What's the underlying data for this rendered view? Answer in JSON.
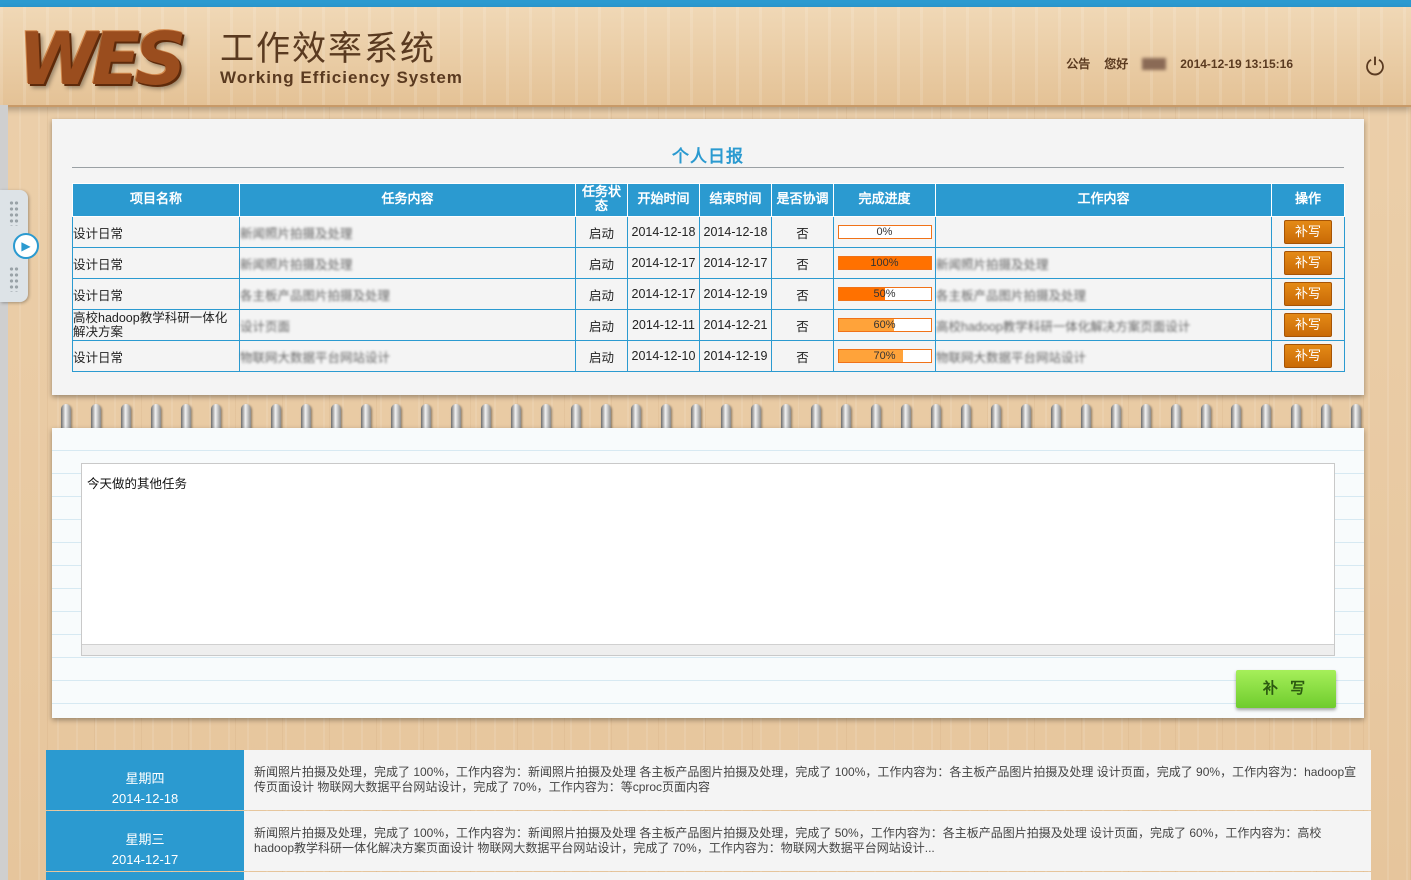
{
  "header": {
    "logo_mark": "WES",
    "title_cn": "工作效率系统",
    "title_en": "Working Efficiency System",
    "announcement": "公告",
    "greeting": "您好",
    "datetime": "2014-12-19 13:15:16"
  },
  "panel": {
    "title": "个人日报",
    "columns": [
      "项目名称",
      "任务内容",
      "任务状态",
      "开始时间",
      "结束时间",
      "是否协调",
      "完成进度",
      "工作内容",
      "操作"
    ],
    "rows": [
      {
        "project": "设计日常",
        "task": "新闻照片拍摄及处理",
        "status": "启动",
        "start": "2014-12-18",
        "end": "2014-12-18",
        "coordinate": "否",
        "progress": 0,
        "progress_label": "0%",
        "content": "",
        "action": "补写"
      },
      {
        "project": "设计日常",
        "task": "新闻照片拍摄及处理",
        "status": "启动",
        "start": "2014-12-17",
        "end": "2014-12-17",
        "coordinate": "否",
        "progress": 100,
        "progress_label": "100%",
        "content": "新闻照片拍摄及处理",
        "action": "补写"
      },
      {
        "project": "设计日常",
        "task": "各主板产品图片拍摄及处理",
        "status": "启动",
        "start": "2014-12-17",
        "end": "2014-12-19",
        "coordinate": "否",
        "progress": 50,
        "progress_label": "50%",
        "content": "各主板产品图片拍摄及处理",
        "action": "补写"
      },
      {
        "project": "高校hadoop教学科研一体化解决方案",
        "task": "设计页面",
        "status": "启动",
        "start": "2014-12-11",
        "end": "2014-12-21",
        "coordinate": "否",
        "progress": 60,
        "progress_label": "60%",
        "content": "高校hadoop教学科研一体化解决方案页面设计",
        "action": "补写"
      },
      {
        "project": "设计日常",
        "task": "物联网大数据平台网站设计",
        "status": "启动",
        "start": "2014-12-10",
        "end": "2014-12-19",
        "coordinate": "否",
        "progress": 70,
        "progress_label": "70%",
        "content": "物联网大数据平台网站设计",
        "action": "补写"
      }
    ]
  },
  "other_tasks": {
    "text": "今天做的其他任务",
    "submit_label": "补 写"
  },
  "history": [
    {
      "weekday": "星期四",
      "date": "2014-12-18",
      "summary": "新闻照片拍摄及处理，完成了 100%，工作内容为：新闻照片拍摄及处理 各主板产品图片拍摄及处理，完成了 100%，工作内容为：各主板产品图片拍摄及处理 设计页面，完成了 90%，工作内容为：hadoop宣传页面设计 物联网大数据平台网站设计，完成了 70%，工作内容为：等cproc页面内容"
    },
    {
      "weekday": "星期三",
      "date": "2014-12-17",
      "summary": "新闻照片拍摄及处理，完成了 100%，工作内容为：新闻照片拍摄及处理 各主板产品图片拍摄及处理，完成了 50%，工作内容为：各主板产品图片拍摄及处理 设计页面，完成了 60%，工作内容为：高校hadoop教学科研一体化解决方案页面设计 物联网大数据平台网站设计，完成了 70%，工作内容为：物联网大数据平台网站设计..."
    }
  ],
  "colors": {
    "accent": "#2b9ad0",
    "progress": "#ff7100",
    "action": "#d87a0e",
    "submit": "#8ede45"
  },
  "icons": [
    "power-icon",
    "play-icon",
    "grip-icon"
  ]
}
